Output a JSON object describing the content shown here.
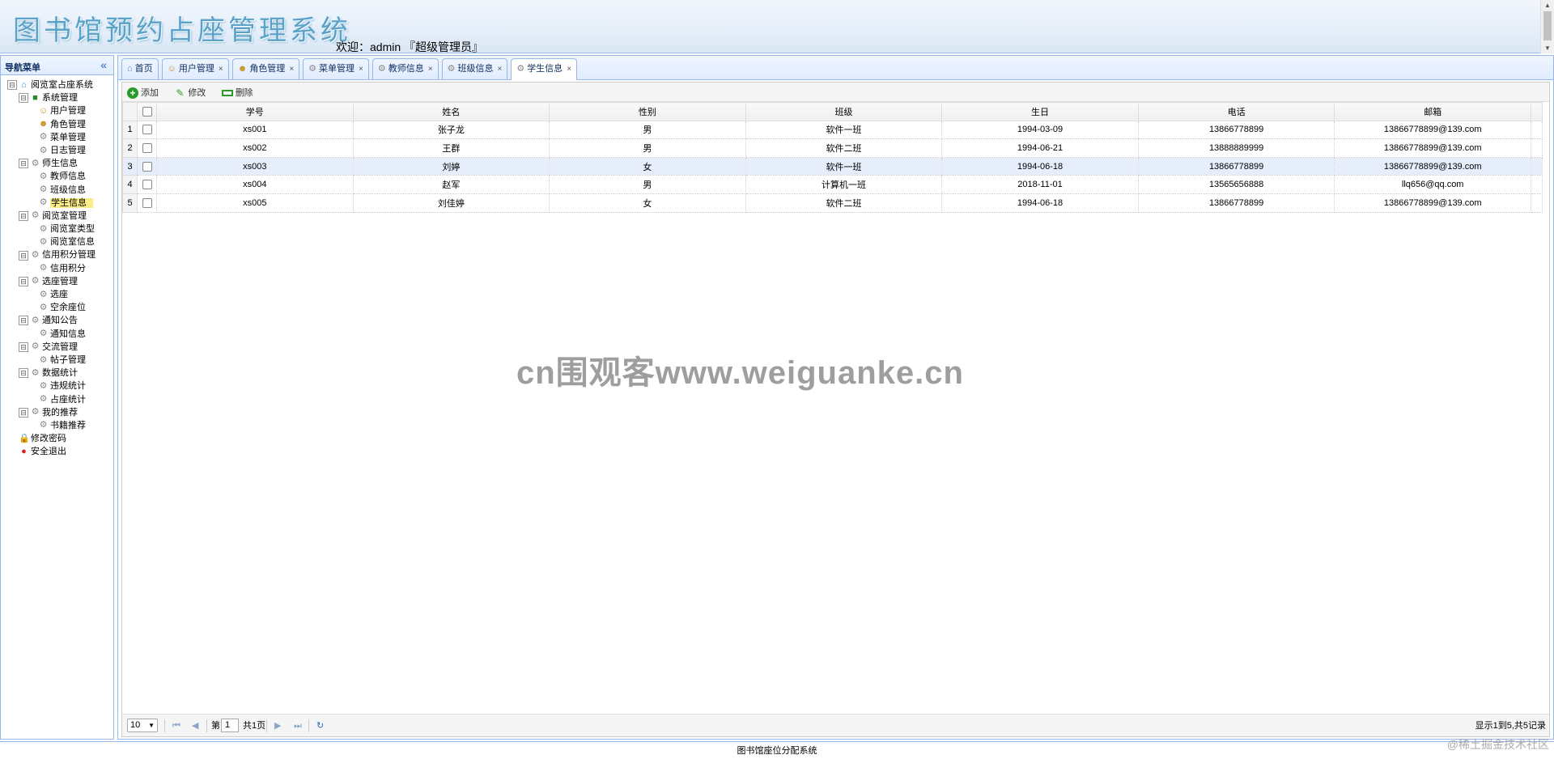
{
  "header": {
    "app_title": "图书馆预约占座管理系统",
    "welcome": "欢迎：admin 『超级管理员』"
  },
  "nav": {
    "title": "导航菜单",
    "collapse_glyph": "«",
    "tree": [
      {
        "label": "阅览室占座系统",
        "level": 0,
        "icon": "home-icon",
        "toggle": "⊟"
      },
      {
        "label": "系统管理",
        "level": 1,
        "icon": "book-icon",
        "toggle": "⊟"
      },
      {
        "label": "用户管理",
        "level": 2,
        "icon": "user-icon"
      },
      {
        "label": "角色管理",
        "level": 2,
        "icon": "users-icon"
      },
      {
        "label": "菜单管理",
        "level": 2,
        "icon": "gear-icon"
      },
      {
        "label": "日志管理",
        "level": 2,
        "icon": "gear-icon"
      },
      {
        "label": "师生信息",
        "level": 1,
        "icon": "gear-icon",
        "toggle": "⊟"
      },
      {
        "label": "教师信息",
        "level": 2,
        "icon": "gear-icon"
      },
      {
        "label": "班级信息",
        "level": 2,
        "icon": "gear-icon"
      },
      {
        "label": "学生信息",
        "level": 2,
        "icon": "gear-icon",
        "selected": true
      },
      {
        "label": "阅览室管理",
        "level": 1,
        "icon": "gear-icon",
        "toggle": "⊟"
      },
      {
        "label": "阅览室类型",
        "level": 2,
        "icon": "gear-icon"
      },
      {
        "label": "阅览室信息",
        "level": 2,
        "icon": "gear-icon"
      },
      {
        "label": "信用积分管理",
        "level": 1,
        "icon": "gear-icon",
        "toggle": "⊟"
      },
      {
        "label": "信用积分",
        "level": 2,
        "icon": "gear-icon"
      },
      {
        "label": "选座管理",
        "level": 1,
        "icon": "gear-icon",
        "toggle": "⊟"
      },
      {
        "label": "选座",
        "level": 2,
        "icon": "gear-icon"
      },
      {
        "label": "空余座位",
        "level": 2,
        "icon": "gear-icon"
      },
      {
        "label": "通知公告",
        "level": 1,
        "icon": "gear-icon",
        "toggle": "⊟"
      },
      {
        "label": "通知信息",
        "level": 2,
        "icon": "gear-icon"
      },
      {
        "label": "交流管理",
        "level": 1,
        "icon": "gear-icon",
        "toggle": "⊟"
      },
      {
        "label": "帖子管理",
        "level": 2,
        "icon": "gear-icon"
      },
      {
        "label": "数据统计",
        "level": 1,
        "icon": "gear-icon",
        "toggle": "⊟"
      },
      {
        "label": "违规统计",
        "level": 2,
        "icon": "gear-icon"
      },
      {
        "label": "占座统计",
        "level": 2,
        "icon": "gear-icon"
      },
      {
        "label": "我的推荐",
        "level": 1,
        "icon": "gear-icon",
        "toggle": "⊟"
      },
      {
        "label": "书籍推荐",
        "level": 2,
        "icon": "gear-icon"
      },
      {
        "label": "修改密码",
        "level": 1,
        "icon": "lock-icon"
      },
      {
        "label": "安全退出",
        "level": 1,
        "icon": "exit-icon"
      }
    ]
  },
  "tabs": [
    {
      "label": "首页",
      "icon": "home-icon",
      "closable": false,
      "active": false
    },
    {
      "label": "用户管理",
      "icon": "user-icon",
      "closable": true,
      "active": false
    },
    {
      "label": "角色管理",
      "icon": "users-icon",
      "closable": true,
      "active": false
    },
    {
      "label": "菜单管理",
      "icon": "gear-icon",
      "closable": true,
      "active": false
    },
    {
      "label": "教师信息",
      "icon": "gear-icon",
      "closable": true,
      "active": false
    },
    {
      "label": "班级信息",
      "icon": "gear-icon",
      "closable": true,
      "active": false
    },
    {
      "label": "学生信息",
      "icon": "gear-icon",
      "closable": true,
      "active": true
    }
  ],
  "toolbar": {
    "add": "添加",
    "edit": "修改",
    "delete": "删除"
  },
  "table": {
    "columns": [
      "学号",
      "姓名",
      "性别",
      "班级",
      "生日",
      "电话",
      "邮箱"
    ],
    "rows": [
      {
        "n": "1",
        "cells": [
          "xs001",
          "张子龙",
          "男",
          "软件一班",
          "1994-03-09",
          "13866778899",
          "13866778899@139.com"
        ]
      },
      {
        "n": "2",
        "cells": [
          "xs002",
          "王群",
          "男",
          "软件二班",
          "1994-06-21",
          "13888889999",
          "13866778899@139.com"
        ]
      },
      {
        "n": "3",
        "cells": [
          "xs003",
          "刘婷",
          "女",
          "软件一班",
          "1994-06-18",
          "13866778899",
          "13866778899@139.com"
        ],
        "highlight": true
      },
      {
        "n": "4",
        "cells": [
          "xs004",
          "赵军",
          "男",
          "计算机一班",
          "2018-11-01",
          "13565656888",
          "llq656@qq.com"
        ]
      },
      {
        "n": "5",
        "cells": [
          "xs005",
          "刘佳婷",
          "女",
          "软件二班",
          "1994-06-18",
          "13866778899",
          "13866778899@139.com"
        ]
      }
    ]
  },
  "pager": {
    "page_size": "10",
    "page_prefix": "第",
    "page_value": "1",
    "page_total": "共1页",
    "info": "显示1到5,共5记录"
  },
  "footer": {
    "text": "图书馆座位分配系统"
  },
  "watermark": "cn围观客www.weiguanke.cn",
  "corner_mark": "@稀土掘金技术社区"
}
